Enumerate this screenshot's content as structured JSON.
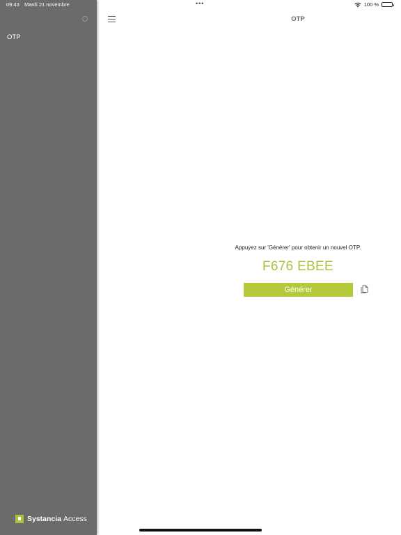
{
  "status_bar": {
    "time": "09:43",
    "date": "Mardi 21 novembre",
    "multitask": "•••",
    "battery": "100 %"
  },
  "sidebar": {
    "items": [
      {
        "label": "OTP"
      }
    ],
    "brand": {
      "name": "Systancia",
      "product": "Access"
    }
  },
  "nav": {
    "title": "OTP"
  },
  "main": {
    "instruction": "Appuyez sur 'Générer' pour obtenir un nouvel OTP.",
    "otp_code": "F676 EBEE",
    "generate_label": "Générer"
  },
  "colors": {
    "sidebar_bg": "#6b6b6b",
    "accent_green": "#b5c83b",
    "otp_text": "#a9c23f"
  },
  "icons": {
    "menu": "hamburger-menu-icon",
    "copy": "copy-icon",
    "wifi": "wifi-icon",
    "battery": "battery-icon",
    "spinner": "loading-spinner-icon",
    "brand": "systancia-logo"
  }
}
